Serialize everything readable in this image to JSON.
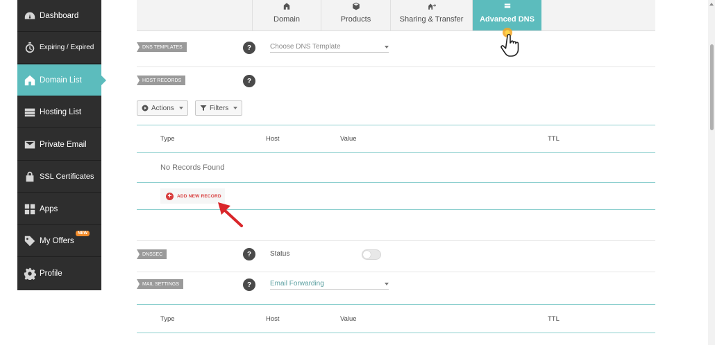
{
  "sidebar": {
    "items": [
      {
        "label": "Dashboard",
        "icon": "gauge-icon"
      },
      {
        "label": "Expiring / Expired",
        "icon": "stopwatch-icon"
      },
      {
        "label": "Domain List",
        "icon": "home-icon",
        "active": true
      },
      {
        "label": "Hosting List",
        "icon": "server-icon"
      },
      {
        "label": "Private Email",
        "icon": "envelope-icon"
      },
      {
        "label": "SSL Certificates",
        "icon": "lock-icon"
      },
      {
        "label": "Apps",
        "icon": "apps-icon"
      },
      {
        "label": "My Offers",
        "icon": "tag-icon",
        "badge": "NEW"
      },
      {
        "label": "Profile",
        "icon": "gear-icon"
      }
    ]
  },
  "tabs": [
    {
      "label": "Domain",
      "icon": "home-icon"
    },
    {
      "label": "Products",
      "icon": "box-icon"
    },
    {
      "label": "Sharing & Transfer",
      "icon": "share-icon"
    },
    {
      "label": "Advanced DNS",
      "icon": "server-stack-icon",
      "active": true
    }
  ],
  "dns_templates": {
    "ribbon": "DNS TEMPLATES",
    "placeholder": "Choose DNS Template"
  },
  "host_records": {
    "ribbon": "HOST RECORDS",
    "actions_label": "Actions",
    "filters_label": "Filters",
    "columns": [
      "Type",
      "Host",
      "Value",
      "TTL"
    ],
    "empty_text": "No Records Found",
    "add_label": "ADD NEW RECORD"
  },
  "dnssec": {
    "ribbon": "DNSSEC",
    "status_label": "Status",
    "enabled": false
  },
  "mail_settings": {
    "ribbon": "MAIL SETTINGS",
    "selected": "Email Forwarding",
    "columns": [
      "Type",
      "Host",
      "Value",
      "TTL"
    ]
  },
  "colors": {
    "accent": "#5cbcbd",
    "sidebar": "#2e2e2e",
    "danger": "#d83c3c",
    "badge": "#f28c2a"
  }
}
